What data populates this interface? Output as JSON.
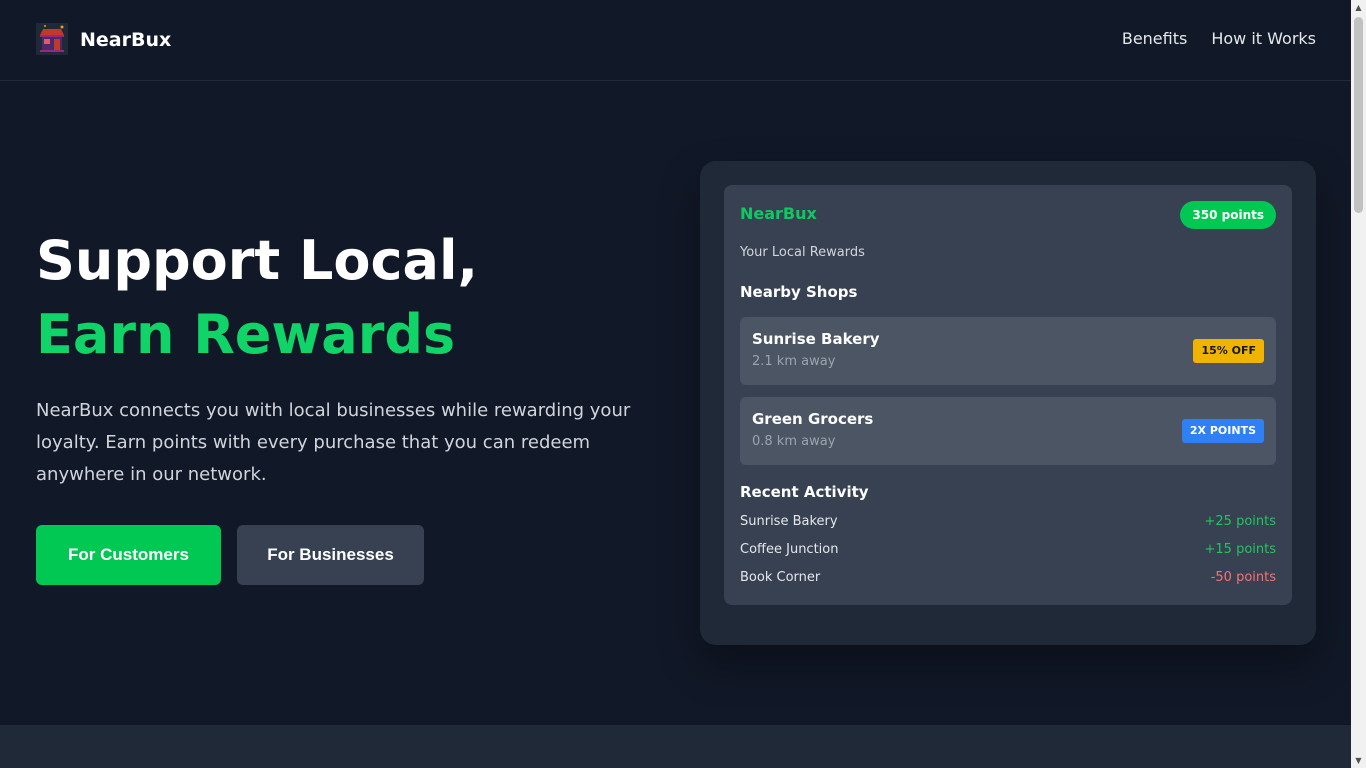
{
  "header": {
    "brand": "NearBux",
    "logo_icon": "storefront-icon",
    "nav": [
      {
        "label": "Benefits"
      },
      {
        "label": "How it Works"
      }
    ]
  },
  "hero": {
    "title_line1": "Support Local,",
    "title_line2": "Earn Rewards",
    "description": "NearBux connects you with local businesses while rewarding your loyalty. Earn points with every purchase that you can redeem anywhere in our network.",
    "btn_customers": "For Customers",
    "btn_businesses": "For Businesses"
  },
  "card": {
    "brand": "NearBux",
    "points": "350 points",
    "subtitle": "Your Local Rewards",
    "shops_heading": "Nearby Shops",
    "shops": [
      {
        "name": "Sunrise Bakery",
        "distance": "2.1 km away",
        "tag": "15% OFF",
        "tag_color": "#f0b400"
      },
      {
        "name": "Green Grocers",
        "distance": "0.8 km away",
        "tag": "2X POINTS",
        "tag_color": "#2f7ff5"
      }
    ],
    "activity_heading": "Recent Activity",
    "activity": [
      {
        "name": "Sunrise Bakery",
        "points": "+25 points"
      },
      {
        "name": "Coffee Junction",
        "points": "+15 points"
      },
      {
        "name": "Book Corner",
        "points": "-50 points"
      }
    ]
  },
  "colors": {
    "background": "#111827",
    "accent_green": "#00c853",
    "card_bg": "#1f2937",
    "panel_bg": "#374151",
    "negative": "#f87171"
  }
}
